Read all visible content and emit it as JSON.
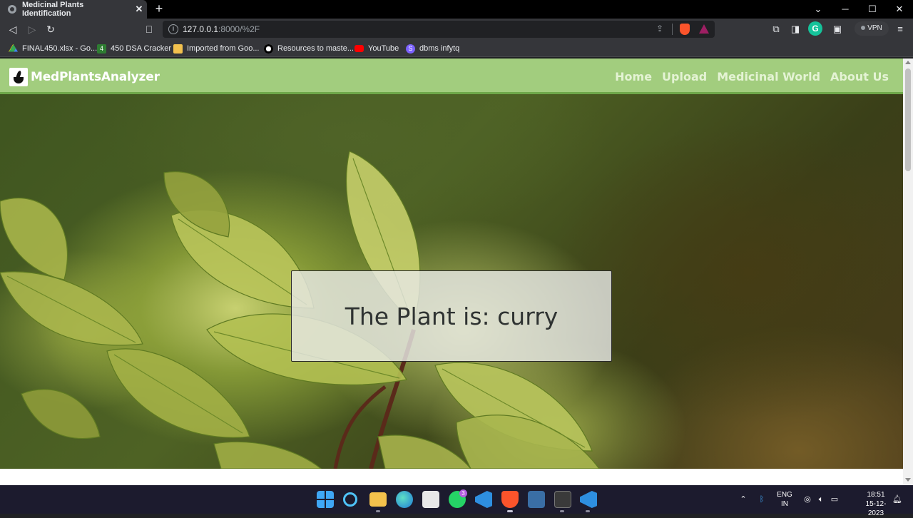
{
  "browser": {
    "tab_title": "Medicinal Plants Identification",
    "tab_close": "✕",
    "new_tab": "+",
    "window_controls": {
      "minimize": "─",
      "maximize": "☐",
      "close": "✕",
      "list": "⌄"
    },
    "url_host": "127.0.0.1",
    "url_path": ":8000/%2F",
    "bookmarks": [
      {
        "label": "FINAL450.xlsx - Go...",
        "icon": "google-drive-icon",
        "color": "#34a853"
      },
      {
        "label": "450 DSA Cracker",
        "icon": "number-4-icon",
        "color": "#2e7d32"
      },
      {
        "label": "Imported from Goo...",
        "icon": "folder-icon",
        "color": "#f2c14e"
      },
      {
        "label": "Resources to maste...",
        "icon": "medium-icon",
        "color": "#ffffff"
      },
      {
        "label": "YouTube",
        "icon": "youtube-icon",
        "color": "#ff0000"
      },
      {
        "label": "dbms infytq",
        "icon": "s-logo-icon",
        "color": "#7b61ff"
      }
    ],
    "vpn_label": "VPN",
    "avatar_letter": "G"
  },
  "site": {
    "brand": "MedPlantsAnalyzer",
    "nav": [
      "Home",
      "Upload",
      "Medicinal World",
      "About Us"
    ],
    "nav_color": "#a2cd7e",
    "result_text": "The Plant is: curry"
  },
  "taskbar": {
    "apps": [
      {
        "name": "windows-start-icon",
        "color": "#3fa7f5"
      },
      {
        "name": "search-icon",
        "color": "#4fc3f7"
      },
      {
        "name": "file-explorer-icon",
        "color": "#f4c24c"
      },
      {
        "name": "edge-icon",
        "color": "#1fa3a3"
      },
      {
        "name": "ms-store-icon",
        "color": "#e8e8e8"
      },
      {
        "name": "whatsapp-icon",
        "color": "#25d366"
      },
      {
        "name": "vscode-icon",
        "color": "#2e8fe0"
      },
      {
        "name": "brave-icon",
        "color": "#fb542b"
      },
      {
        "name": "app-icon",
        "color": "#3a6ea5"
      },
      {
        "name": "terminal-icon",
        "color": "#3a3a3a"
      },
      {
        "name": "vscode-icon-2",
        "color": "#2e8fe0"
      }
    ],
    "whatsapp_badge": "3",
    "lang_top": "ENG",
    "lang_bottom": "IN",
    "time": "18:51",
    "date": "15-12-2023"
  }
}
